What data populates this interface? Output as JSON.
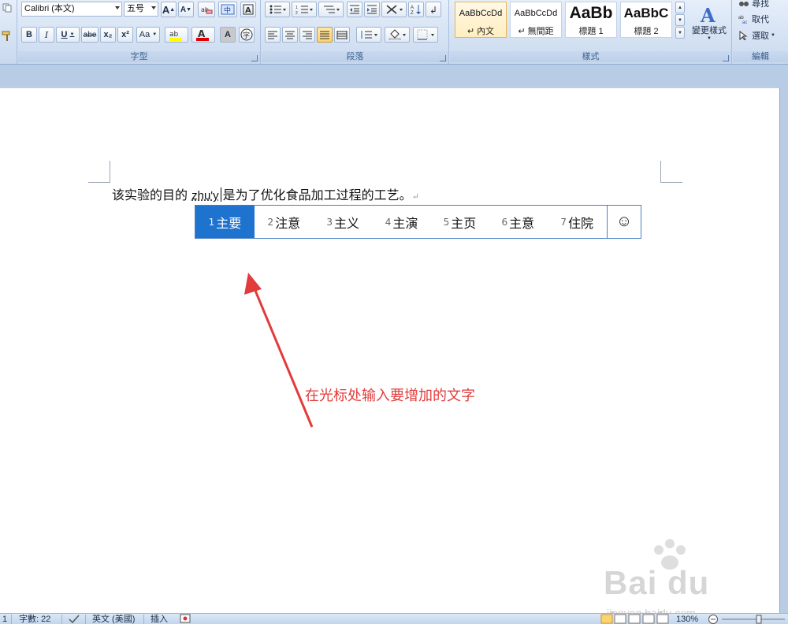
{
  "ribbon": {
    "font_name": "Calibri (本文)",
    "font_size": "五号",
    "group_font_label": "字型",
    "group_paragraph_label": "段落",
    "group_styles_label": "樣式",
    "group_editing_label": "編輯",
    "bold": "B",
    "italic": "I",
    "underline": "U",
    "strike": "abe",
    "subscript": "x₂",
    "superscript": "x²",
    "change_case": "Aa",
    "grow_font": "A",
    "shrink_font": "A",
    "styles": [
      {
        "preview": "AaBbCcDd",
        "name": "↵ 內文"
      },
      {
        "preview": "AaBbCcDd",
        "name": "↵ 無間距"
      },
      {
        "preview": "AaBb",
        "name": "標題 1"
      },
      {
        "preview": "AaBbC",
        "name": "標題 2"
      }
    ],
    "change_styles": "變更樣式",
    "find": "尋找",
    "replace": "取代",
    "select": "選取"
  },
  "document": {
    "text_before": "该实验的目的",
    "pinyin": "zhu'y",
    "text_after": "是为了优化食品加工过程的工艺。",
    "para_mark": "↵"
  },
  "ime": {
    "candidates": [
      {
        "num": "1",
        "text": "主要"
      },
      {
        "num": "2",
        "text": "注意"
      },
      {
        "num": "3",
        "text": "主义"
      },
      {
        "num": "4",
        "text": "主演"
      },
      {
        "num": "5",
        "text": "主页"
      },
      {
        "num": "6",
        "text": "主意"
      },
      {
        "num": "7",
        "text": "住院"
      }
    ],
    "selected_index": 0,
    "emoji": "☺"
  },
  "annotation": {
    "text": "在光标处输入要增加的文字",
    "color": "#e23b3b"
  },
  "watermark": {
    "brand": "Bai du 经验",
    "url": "jingyan.baidu.com"
  },
  "status": {
    "page": "1",
    "word_count": "字數: 22",
    "language": "英文 (美國)",
    "mode": "插入",
    "zoom": "130%"
  }
}
